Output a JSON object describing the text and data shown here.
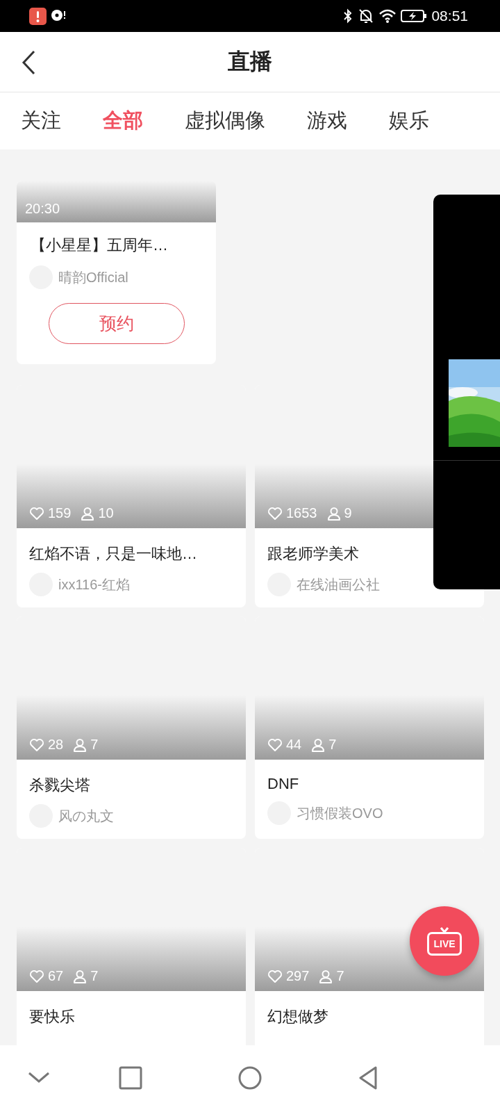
{
  "status_bar": {
    "time": "08:51"
  },
  "header": {
    "title": "直播"
  },
  "tabs": [
    {
      "label": "关注",
      "selected": false
    },
    {
      "label": "全部",
      "selected": true
    },
    {
      "label": "虚拟偶像",
      "selected": false
    },
    {
      "label": "游戏",
      "selected": false
    },
    {
      "label": "娱乐",
      "selected": false
    }
  ],
  "reservation": {
    "time": "20:30",
    "title": "【小星星】五周年…",
    "streamer": "晴韵Official",
    "button": "预约"
  },
  "streams": [
    {
      "likes": "159",
      "viewers": "10",
      "title": "红焰不语，只是一味地…",
      "streamer": "ixx116-红焰"
    },
    {
      "likes": "1653",
      "viewers": "9",
      "title": "跟老师学美术",
      "streamer": "在线油画公社"
    },
    {
      "likes": "28",
      "viewers": "7",
      "title": "杀戮尖塔",
      "streamer": "风の丸文"
    },
    {
      "likes": "44",
      "viewers": "7",
      "title": "DNF",
      "streamer": "习惯假装OVO"
    },
    {
      "likes": "67",
      "viewers": "7",
      "title": "要快乐"
    },
    {
      "likes": "297",
      "viewers": "7",
      "title": "幻想做梦"
    }
  ],
  "live_button": {
    "label": "LIVE"
  }
}
